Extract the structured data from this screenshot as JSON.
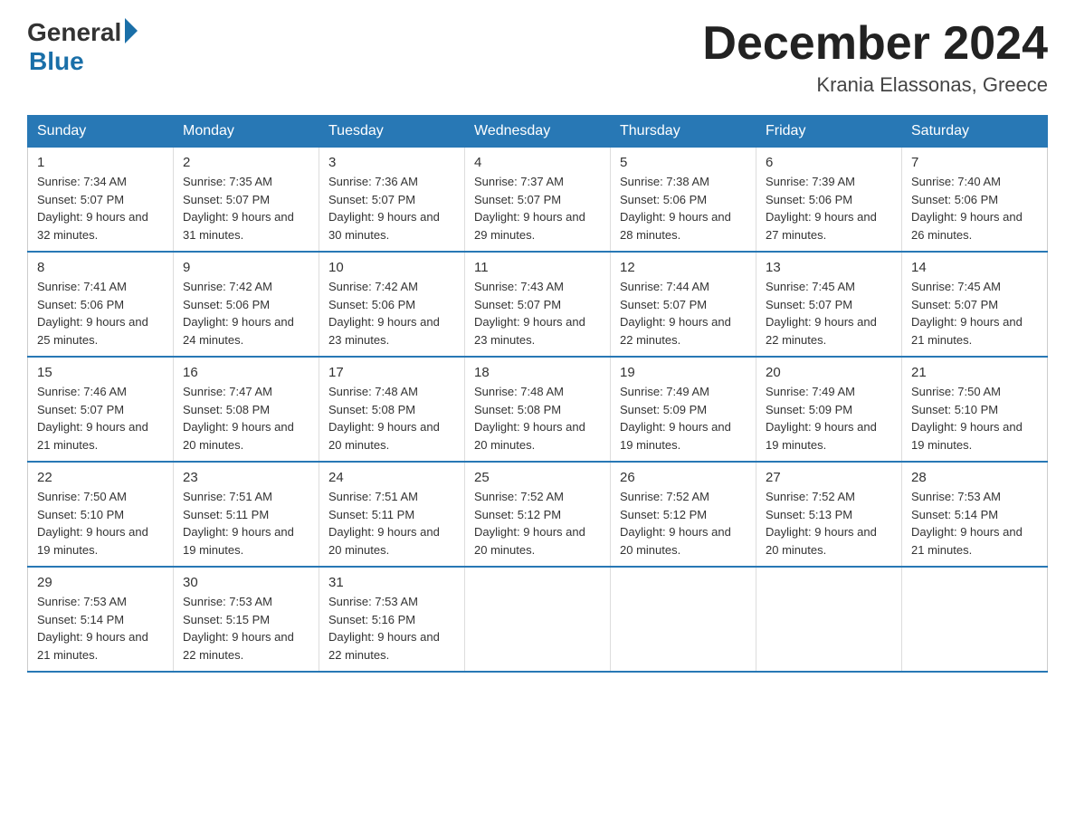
{
  "logo": {
    "general": "General",
    "blue": "Blue"
  },
  "title": {
    "month_year": "December 2024",
    "location": "Krania Elassonas, Greece"
  },
  "days_of_week": [
    "Sunday",
    "Monday",
    "Tuesday",
    "Wednesday",
    "Thursday",
    "Friday",
    "Saturday"
  ],
  "weeks": [
    [
      {
        "day": "1",
        "sunrise": "7:34 AM",
        "sunset": "5:07 PM",
        "daylight": "9 hours and 32 minutes."
      },
      {
        "day": "2",
        "sunrise": "7:35 AM",
        "sunset": "5:07 PM",
        "daylight": "9 hours and 31 minutes."
      },
      {
        "day": "3",
        "sunrise": "7:36 AM",
        "sunset": "5:07 PM",
        "daylight": "9 hours and 30 minutes."
      },
      {
        "day": "4",
        "sunrise": "7:37 AM",
        "sunset": "5:07 PM",
        "daylight": "9 hours and 29 minutes."
      },
      {
        "day": "5",
        "sunrise": "7:38 AM",
        "sunset": "5:06 PM",
        "daylight": "9 hours and 28 minutes."
      },
      {
        "day": "6",
        "sunrise": "7:39 AM",
        "sunset": "5:06 PM",
        "daylight": "9 hours and 27 minutes."
      },
      {
        "day": "7",
        "sunrise": "7:40 AM",
        "sunset": "5:06 PM",
        "daylight": "9 hours and 26 minutes."
      }
    ],
    [
      {
        "day": "8",
        "sunrise": "7:41 AM",
        "sunset": "5:06 PM",
        "daylight": "9 hours and 25 minutes."
      },
      {
        "day": "9",
        "sunrise": "7:42 AM",
        "sunset": "5:06 PM",
        "daylight": "9 hours and 24 minutes."
      },
      {
        "day": "10",
        "sunrise": "7:42 AM",
        "sunset": "5:06 PM",
        "daylight": "9 hours and 23 minutes."
      },
      {
        "day": "11",
        "sunrise": "7:43 AM",
        "sunset": "5:07 PM",
        "daylight": "9 hours and 23 minutes."
      },
      {
        "day": "12",
        "sunrise": "7:44 AM",
        "sunset": "5:07 PM",
        "daylight": "9 hours and 22 minutes."
      },
      {
        "day": "13",
        "sunrise": "7:45 AM",
        "sunset": "5:07 PM",
        "daylight": "9 hours and 22 minutes."
      },
      {
        "day": "14",
        "sunrise": "7:45 AM",
        "sunset": "5:07 PM",
        "daylight": "9 hours and 21 minutes."
      }
    ],
    [
      {
        "day": "15",
        "sunrise": "7:46 AM",
        "sunset": "5:07 PM",
        "daylight": "9 hours and 21 minutes."
      },
      {
        "day": "16",
        "sunrise": "7:47 AM",
        "sunset": "5:08 PM",
        "daylight": "9 hours and 20 minutes."
      },
      {
        "day": "17",
        "sunrise": "7:48 AM",
        "sunset": "5:08 PM",
        "daylight": "9 hours and 20 minutes."
      },
      {
        "day": "18",
        "sunrise": "7:48 AM",
        "sunset": "5:08 PM",
        "daylight": "9 hours and 20 minutes."
      },
      {
        "day": "19",
        "sunrise": "7:49 AM",
        "sunset": "5:09 PM",
        "daylight": "9 hours and 19 minutes."
      },
      {
        "day": "20",
        "sunrise": "7:49 AM",
        "sunset": "5:09 PM",
        "daylight": "9 hours and 19 minutes."
      },
      {
        "day": "21",
        "sunrise": "7:50 AM",
        "sunset": "5:10 PM",
        "daylight": "9 hours and 19 minutes."
      }
    ],
    [
      {
        "day": "22",
        "sunrise": "7:50 AM",
        "sunset": "5:10 PM",
        "daylight": "9 hours and 19 minutes."
      },
      {
        "day": "23",
        "sunrise": "7:51 AM",
        "sunset": "5:11 PM",
        "daylight": "9 hours and 19 minutes."
      },
      {
        "day": "24",
        "sunrise": "7:51 AM",
        "sunset": "5:11 PM",
        "daylight": "9 hours and 20 minutes."
      },
      {
        "day": "25",
        "sunrise": "7:52 AM",
        "sunset": "5:12 PM",
        "daylight": "9 hours and 20 minutes."
      },
      {
        "day": "26",
        "sunrise": "7:52 AM",
        "sunset": "5:12 PM",
        "daylight": "9 hours and 20 minutes."
      },
      {
        "day": "27",
        "sunrise": "7:52 AM",
        "sunset": "5:13 PM",
        "daylight": "9 hours and 20 minutes."
      },
      {
        "day": "28",
        "sunrise": "7:53 AM",
        "sunset": "5:14 PM",
        "daylight": "9 hours and 21 minutes."
      }
    ],
    [
      {
        "day": "29",
        "sunrise": "7:53 AM",
        "sunset": "5:14 PM",
        "daylight": "9 hours and 21 minutes."
      },
      {
        "day": "30",
        "sunrise": "7:53 AM",
        "sunset": "5:15 PM",
        "daylight": "9 hours and 22 minutes."
      },
      {
        "day": "31",
        "sunrise": "7:53 AM",
        "sunset": "5:16 PM",
        "daylight": "9 hours and 22 minutes."
      },
      null,
      null,
      null,
      null
    ]
  ]
}
